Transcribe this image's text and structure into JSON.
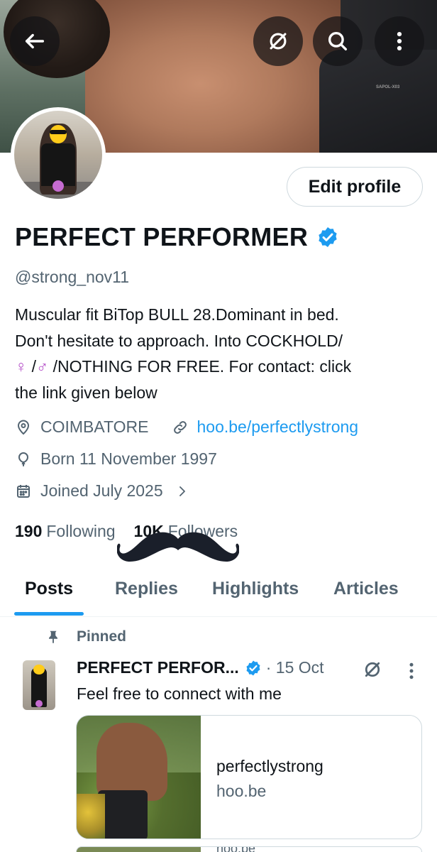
{
  "header": {
    "back_icon": "arrow-left-icon",
    "grok_icon": "slashed-circle-icon",
    "search_icon": "search-icon",
    "more_icon": "more-vertical-icon",
    "banner_text": "SAPOL-X03"
  },
  "profile": {
    "edit_label": "Edit profile",
    "display_name": "PERFECT PERFORMER",
    "verified_icon": "verified-badge-icon",
    "verified_color": "#1d9bf0",
    "handle": "@strong_nov11",
    "bio_line1": "Muscular fit BiTop BULL 28.Dominant in bed.",
    "bio_line2": "Don't hesitate to approach. Into COCKHOLD/",
    "bio_symbol_female": "♀",
    "bio_slash": " /",
    "bio_symbol_male": "♂",
    "bio_line3_rest": " /NOTHING  FOR FREE. For contact: click",
    "bio_line4": "the link given below",
    "location": "COIMBATORE",
    "website": "hoo.be/perfectlystrong",
    "born": "Born 11 November 1997",
    "joined": "Joined July 2025",
    "following_count": "190",
    "following_label": "Following",
    "followers_count": "10K",
    "followers_label": "Followers"
  },
  "tabs": [
    {
      "label": "Posts",
      "active": true
    },
    {
      "label": "Replies",
      "active": false
    },
    {
      "label": "Highlights",
      "active": false
    },
    {
      "label": "Articles",
      "active": false
    }
  ],
  "pinned_tweet": {
    "pinned_label": "Pinned",
    "author_name": "PERFECT PERFOR...",
    "date": "· 15 Oct",
    "text": "Feel free to connect with me",
    "card_title": "perfectlystrong",
    "card_domain": "hoo.be"
  },
  "next_peek_text": "hoo.be",
  "colors": {
    "accent": "#1d9bf0",
    "text_primary": "#0f1419",
    "text_secondary": "#536471",
    "border": "#cfd9de"
  }
}
